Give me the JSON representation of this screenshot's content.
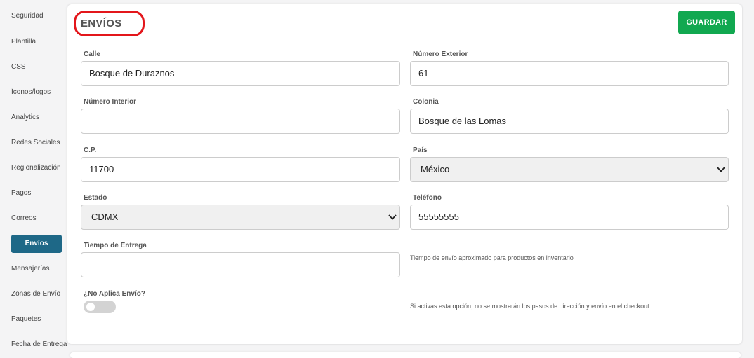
{
  "sidebar": {
    "items": [
      {
        "label": "Seguridad"
      },
      {
        "label": "Plantilla"
      },
      {
        "label": "CSS"
      },
      {
        "label": "Íconos/logos"
      },
      {
        "label": "Analytics"
      },
      {
        "label": "Redes Sociales"
      },
      {
        "label": "Regionalización"
      },
      {
        "label": "Pagos"
      },
      {
        "label": "Correos"
      },
      {
        "label": "Envíos"
      },
      {
        "label": "Mensajerías"
      },
      {
        "label": "Zonas de Envío"
      },
      {
        "label": "Paquetes"
      },
      {
        "label": "Fecha de Entrega"
      }
    ],
    "active": "Envíos"
  },
  "header": {
    "title": "ENVÍOS",
    "save_label": "GUARDAR"
  },
  "form": {
    "calle": {
      "label": "Calle",
      "value": "Bosque de Duraznos"
    },
    "numero_exterior": {
      "label": "Número Exterior",
      "value": "61"
    },
    "numero_interior": {
      "label": "Número Interior",
      "value": ""
    },
    "colonia": {
      "label": "Colonia",
      "value": "Bosque de las Lomas"
    },
    "cp": {
      "label": "C.P.",
      "value": "11700"
    },
    "pais": {
      "label": "País",
      "value": "México"
    },
    "estado": {
      "label": "Estado",
      "value": "CDMX"
    },
    "telefono": {
      "label": "Teléfono",
      "value": "55555555"
    },
    "tiempo_entrega": {
      "label": "Tiempo de Entrega",
      "value": "",
      "help": "Tiempo de envío aproximado para productos en inventario"
    },
    "no_aplica_envio": {
      "label": "¿No Aplica Envío?",
      "checked": false,
      "help": "Si activas esta opción, no se mostrarán los pasos de dirección y envío en el checkout."
    }
  },
  "colors": {
    "accent": "#1e6887",
    "save": "#11a850",
    "highlight_ring": "#e3161b"
  }
}
